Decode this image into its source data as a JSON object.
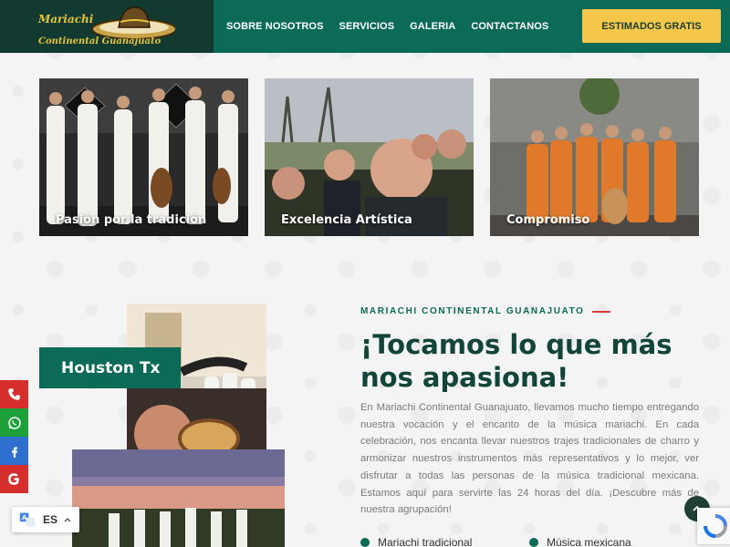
{
  "header": {
    "logo_line1": "Mariachi",
    "logo_line2": "Continental Guanajuato",
    "nav": [
      "SOBRE NOSOTROS",
      "SERVICIOS",
      "GALERIA",
      "CONTACTANOS"
    ],
    "cta": "ESTIMADOS GRATIS"
  },
  "cards": [
    {
      "label": "Pasión por la tradición"
    },
    {
      "label": "Excelencia Artística"
    },
    {
      "label": "Compromiso"
    }
  ],
  "collage": {
    "badge": "Houston Tx"
  },
  "about": {
    "eyebrow": "MARIACHI CONTINENTAL GUANAJUATO",
    "heading": "¡Tocamos lo que más nos apasiona!",
    "body": "En Mariachi Continental Guanajuato, llevamos mucho tiempo entregando nuestra vocación y el encanto de la música mariachi. En cada celebración, nos encanta llevar nuestros trajes tradicionales de charro y armonizar nuestros instrumentos más representativos y lo mejor, ver disfrutar a todas las personas de la música tradicional mexicana. Estamos aquí para servirte las 24 horas del día. ¡Descubre más de nuestra agrupación!",
    "features": [
      "Mariachi tradicional",
      "Música mexicana"
    ]
  },
  "language": {
    "code": "ES"
  },
  "colors": {
    "primary": "#0b6b57",
    "accent": "#f4c64a",
    "dark": "#12443a",
    "red": "#d63a3a"
  },
  "social": [
    "phone-icon",
    "whatsapp-icon",
    "facebook-icon",
    "google-icon"
  ]
}
